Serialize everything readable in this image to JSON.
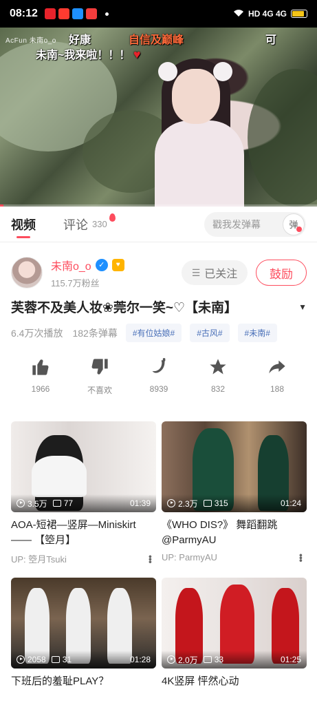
{
  "status_bar": {
    "time": "08:12",
    "network": "HD 4G 4G",
    "battery_level": 0.85
  },
  "video": {
    "watermark": "AcFun 未南o_o",
    "danmaku": [
      {
        "text": "好康",
        "color": "#ffffff"
      },
      {
        "text": "自信及巅峰",
        "color": "#ff6a3a"
      },
      {
        "text": "可",
        "color": "#ffffff"
      },
      {
        "text": "未南~我来啦！！！",
        "color": "#ffffff"
      }
    ],
    "progress": 0.01
  },
  "tabs": {
    "video_label": "视频",
    "comments_label": "评论",
    "comments_count": "330",
    "danmu_placeholder": "戳我发弹幕",
    "danmu_toggle": "弹"
  },
  "author": {
    "name": "未南o_o",
    "fans": "115.7万粉丝",
    "follow_label": "已关注",
    "reward_label": "鼓励"
  },
  "video_info": {
    "title": "芙蓉不及美人妆❀莞尔一笑~♡【未南】",
    "plays": "6.4万次播放",
    "danmu": "182条弹幕",
    "tags": [
      "#有位姑娘#",
      "#古风#",
      "#未南#"
    ]
  },
  "actions": [
    {
      "icon": "thumbs-up-icon",
      "label": "1966"
    },
    {
      "icon": "thumbs-down-icon",
      "label": "不喜欢"
    },
    {
      "icon": "banana-icon",
      "label": "8939"
    },
    {
      "icon": "star-icon",
      "label": "832"
    },
    {
      "icon": "share-icon",
      "label": "188"
    }
  ],
  "related": [
    {
      "views": "3.5万",
      "comments": "77",
      "duration": "01:39",
      "title": "AOA-短裙—竖屏—Miniskirt—— 【箜月】",
      "up": "UP: 箜月Tsuki"
    },
    {
      "views": "2.3万",
      "comments": "315",
      "duration": "01:24",
      "title": "《WHO DIS?》 舞蹈翻跳 @ParmyAU",
      "up": "UP: ParmyAU"
    },
    {
      "views": "2058",
      "comments": "31",
      "duration": "01:28",
      "title": "下班后的羞耻PLAY？",
      "up": ""
    },
    {
      "views": "2.0万",
      "comments": "33",
      "duration": "01:25",
      "title": "4K竖屏 怦然心动",
      "up": ""
    }
  ],
  "colors": {
    "accent": "#fd4c5d",
    "tag_text": "#4a70b8",
    "verify": "#1e90ff"
  }
}
